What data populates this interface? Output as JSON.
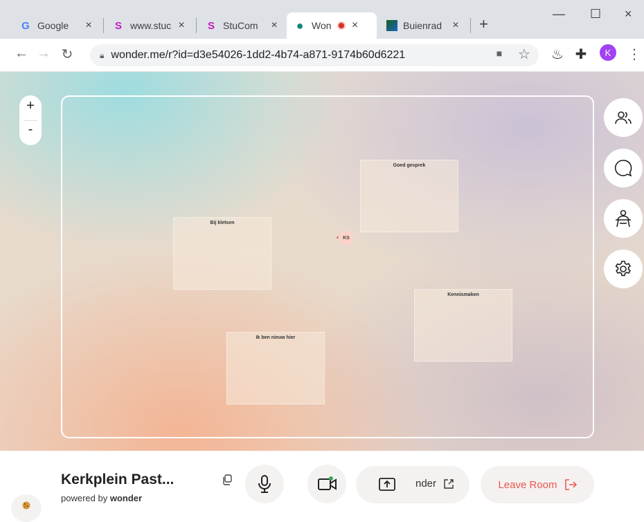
{
  "browser": {
    "tabs": [
      {
        "title": "Google",
        "favicon": "G"
      },
      {
        "title": "www.stuc",
        "favicon": "S"
      },
      {
        "title": "StuCom",
        "favicon": "S"
      },
      {
        "title": "Won",
        "favicon": "●"
      },
      {
        "title": "Buienrad",
        "favicon": "▚"
      }
    ],
    "new_tab": "+",
    "close_glyph": "×",
    "url": "wonder.me/r?id=d3e54026-1dd2-4b74-a871-9174b60d6221",
    "profile_initial": "K"
  },
  "room": {
    "zoom_in": "+",
    "zoom_out": "-",
    "areas": [
      {
        "label": "Bij kletsen"
      },
      {
        "label": "Goed gesprek"
      },
      {
        "label": "Kennismaken"
      },
      {
        "label": "Ik ben nieuw hier"
      }
    ],
    "avatar_initials": "KS"
  },
  "bottom": {
    "room_name": "Kerkplein Past...",
    "powered_prefix": "powered by",
    "powered_brand": "wonder",
    "share_label": "nder",
    "leave_label": "Leave Room"
  },
  "colors": {
    "leave_red": "#e8564b",
    "profile_purple": "#a142f4",
    "camera_dot_green": "#34a853"
  }
}
